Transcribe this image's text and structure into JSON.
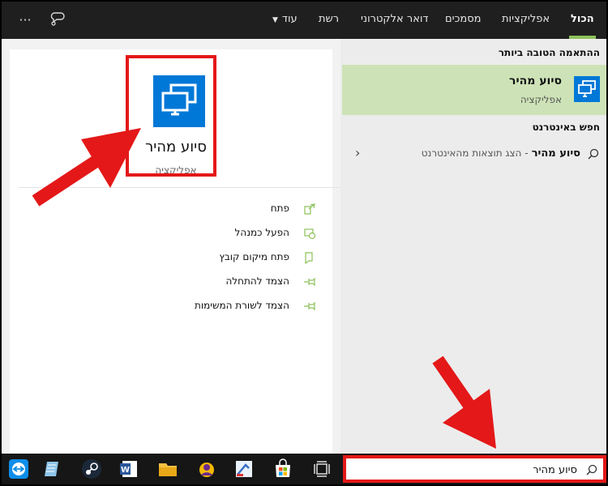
{
  "topbar": {
    "tabs": [
      {
        "label": "הכול",
        "active": true
      },
      {
        "label": "אפליקציות",
        "active": false
      },
      {
        "label": "מסמכים",
        "active": false
      },
      {
        "label": "דואר אלקטרוני",
        "active": false
      },
      {
        "label": "רשת",
        "active": false
      },
      {
        "label": "עוד",
        "active": false,
        "has_dropdown": true
      }
    ],
    "icons": [
      "more-options-icon",
      "feedback-icon"
    ]
  },
  "results": {
    "best_match_header": "ההתאמה הטובה ביותר",
    "best_match": {
      "title": "סיוע מהיר",
      "subtitle": "אפליקציה",
      "icon": "quick-assist-icon"
    },
    "web_header": "חפש באינטרנט",
    "web_row": {
      "query": "סיוע מהיר",
      "suffix": "- הצג תוצאות מהאינטרנט"
    }
  },
  "preview": {
    "name": "סיוע מהיר",
    "type": "אפליקציה",
    "actions": [
      {
        "label": "פתח",
        "icon": "open-icon"
      },
      {
        "label": "הפעל כמנהל",
        "icon": "run-as-admin-icon"
      },
      {
        "label": "פתח מיקום קובץ",
        "icon": "file-location-icon"
      },
      {
        "label": "הצמד להתחלה",
        "icon": "pin-icon"
      },
      {
        "label": "הצמד לשורת המשימות",
        "icon": "pin-icon"
      }
    ]
  },
  "taskbar": {
    "search_value": "סיוע מהיר",
    "icons": [
      "task-view-icon",
      "store-icon",
      "paint-icon",
      "avatar-app-icon",
      "file-explorer-icon",
      "word-icon",
      "steam-icon",
      "notepad-icon",
      "teamviewer-icon"
    ]
  },
  "colors": {
    "accent": "#8ec15a",
    "best_match_bg": "#cde3b7",
    "app_icon_bg": "#0078d7",
    "highlight_red": "#e41818"
  }
}
